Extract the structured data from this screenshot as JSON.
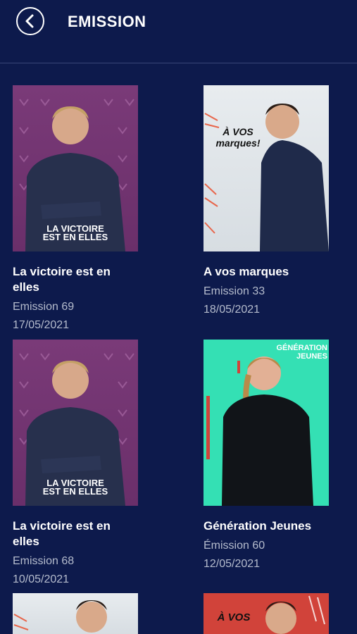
{
  "header": {
    "title": "EMISSION",
    "back_icon": "back-arrow-icon"
  },
  "cards": [
    {
      "title": "La victoire est en elles",
      "episode": "Emission 69",
      "date": "17/05/2021",
      "thumb_logo": "LA VICTOIRE\nEST EN ELLES"
    },
    {
      "title": "A vos marques",
      "episode": "Emission 33",
      "date": "18/05/2021",
      "thumb_logo": "À VOS\nmarques!"
    },
    {
      "title": "La victoire est en elles",
      "episode": "Emission 68",
      "date": "10/05/2021",
      "thumb_logo": "LA VICTOIRE\nEST EN ELLES"
    },
    {
      "title": "Génération Jeunes",
      "episode": "Émission 60",
      "date": "12/05/2021",
      "thumb_logo": "GÉNÉRATION\nJEUNES"
    }
  ],
  "partial_cards": [
    {
      "thumb_logo": ""
    },
    {
      "thumb_logo": "À VOS"
    }
  ],
  "colors": {
    "background": "#0d1a4c",
    "text_primary": "#ffffff",
    "text_secondary": "#b5bccd"
  }
}
